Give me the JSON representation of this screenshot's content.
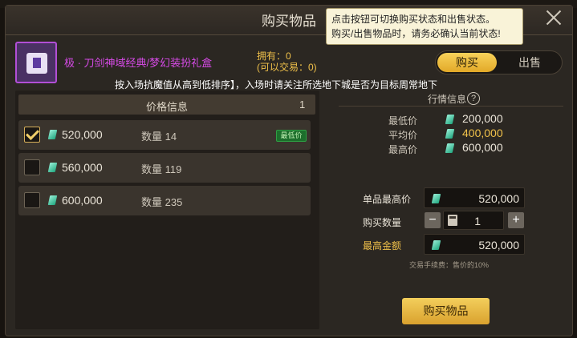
{
  "window": {
    "title": "购买物品"
  },
  "tooltip": {
    "line1": "点击按钮可切换购买状态和出售状态。",
    "line2": "购买/出售物品时，请务必确认当前状态!"
  },
  "item": {
    "name": "极 · 刀剑神域经典/梦幻装扮礼盒",
    "owned": "拥有：0",
    "tradable": "(可以交易：0)"
  },
  "mode_toggle": {
    "buy": "购买",
    "sell": "出售",
    "active": "buy"
  },
  "notice": "按入场抗魔值从高到低排序】，入场时请关注所选地下城是否为目标周常地下",
  "price_list": {
    "header": "价格信息",
    "count": "1",
    "rows": [
      {
        "price": "520,000",
        "quantity": "数量 14",
        "badge": "最低价",
        "checked": true
      },
      {
        "price": "560,000",
        "quantity": "数量 119",
        "badge": "",
        "checked": false
      },
      {
        "price": "600,000",
        "quantity": "数量 235",
        "badge": "",
        "checked": false
      }
    ]
  },
  "market": {
    "title": "行情信息",
    "info_icon": "?",
    "min_label": "最低价",
    "min_value": "200,000",
    "avg_label": "平均价",
    "avg_value": "400,000",
    "max_label": "最高价",
    "max_value": "600,000"
  },
  "purchase_form": {
    "unit_max_label": "单品最高价",
    "unit_max_value": "520,000",
    "qty_label": "购买数量",
    "qty_value": "1",
    "minus": "−",
    "plus": "+",
    "total_label": "最高金额",
    "total_value": "520,000",
    "fee_note": "交易手续费：售价的10%"
  },
  "buy_button": "购买物品",
  "colors": {
    "accent_gold": "#f0c14a",
    "item_purple": "#d64ae6",
    "lowest_green": "#2ea043",
    "gem_teal": "#3cc9a0"
  }
}
